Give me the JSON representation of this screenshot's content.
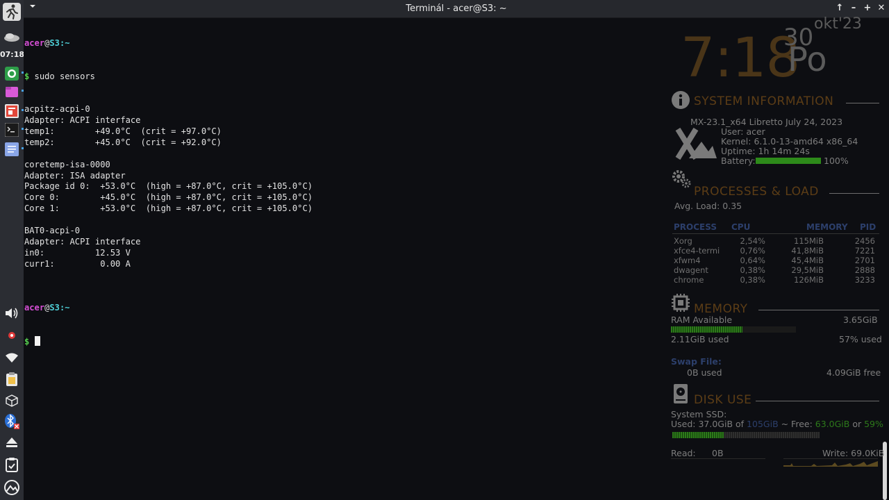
{
  "panel": {
    "clock": "07:18"
  },
  "window": {
    "title": "Terminál - acer@S3: ~",
    "menu_icon": "chevron-down-icon",
    "buttons": [
      "↑",
      "–",
      "+",
      "✕"
    ]
  },
  "terminal": {
    "prompt_user": "acer",
    "prompt_at": "@",
    "prompt_host": "S3",
    "prompt_path": ":~",
    "prompt_symbol": "$",
    "command": " sudo sensors",
    "output": [
      "acpitz-acpi-0",
      "Adapter: ACPI interface",
      "temp1:        +49.0°C  (crit = +97.0°C)",
      "temp2:        +45.0°C  (crit = +92.0°C)",
      "",
      "coretemp-isa-0000",
      "Adapter: ISA adapter",
      "Package id 0:  +53.0°C  (high = +87.0°C, crit = +105.0°C)",
      "Core 0:        +45.0°C  (high = +87.0°C, crit = +105.0°C)",
      "Core 1:        +53.0°C  (high = +87.0°C, crit = +105.0°C)",
      "",
      "BAT0-acpi-0",
      "Adapter: ACPI interface",
      "in0:          12.53 V",
      "curr1:         0.00 A",
      ""
    ]
  },
  "conky": {
    "time": "7:18",
    "day": "30",
    "month_year": "okt'23",
    "dayname": "Po",
    "system": {
      "title": "SYSTEM INFORMATION",
      "distro": "MX-23.1_x64 Libretto July 24, 2023",
      "user": "User: acer",
      "kernel": "Kernel: 6.1.0-13-amd64 x86_64",
      "uptime": "Uptime: 1h 14m 24s",
      "battery_label": "Battery:",
      "battery_pct": "100%",
      "battery_level": 1.0
    },
    "processes": {
      "title": "PROCESSES & LOAD",
      "avg_load": "Avg. Load: 0.35",
      "headers": [
        "PROCESS",
        "CPU",
        "MEMORY",
        "PID"
      ],
      "rows": [
        [
          "Xorg",
          "2,54%",
          "115MiB",
          "2456"
        ],
        [
          "xfce4-termi",
          "0,76%",
          "41,8MiB",
          "7221"
        ],
        [
          "xfwm4",
          "0,64%",
          "45,4MiB",
          "2701"
        ],
        [
          "dwagent",
          "0,38%",
          "29,5MiB",
          "2888"
        ],
        [
          "chrome",
          "0,38%",
          "126MiB",
          "3233"
        ]
      ]
    },
    "memory": {
      "title": "MEMORY",
      "ram_label": "RAM Available",
      "ram_value": "3.65GiB",
      "ram_level": 0.57,
      "used": "2.11GiB used",
      "used_pct": "57% used",
      "swap_label": "Swap File:",
      "swap_used": "0B used",
      "swap_free": "4.09GiB free"
    },
    "disk": {
      "title": "DISK USE",
      "label": "System SSD:",
      "used_prefix": "Used: 37.0GiB of ",
      "total": "105GiB",
      "free_prefix": " ~ Free: ",
      "free": "63.0GiB",
      "or": " or ",
      "free_pct": "59%",
      "used_level": 0.35,
      "read_label": "Read:",
      "read_value": "0B",
      "write_label": "Write: 69.0KiB"
    },
    "colors": {
      "section": "#5c3d16",
      "time": "#4a3518",
      "blue": "#2c3f6b",
      "green": "#2d7a1a"
    }
  }
}
